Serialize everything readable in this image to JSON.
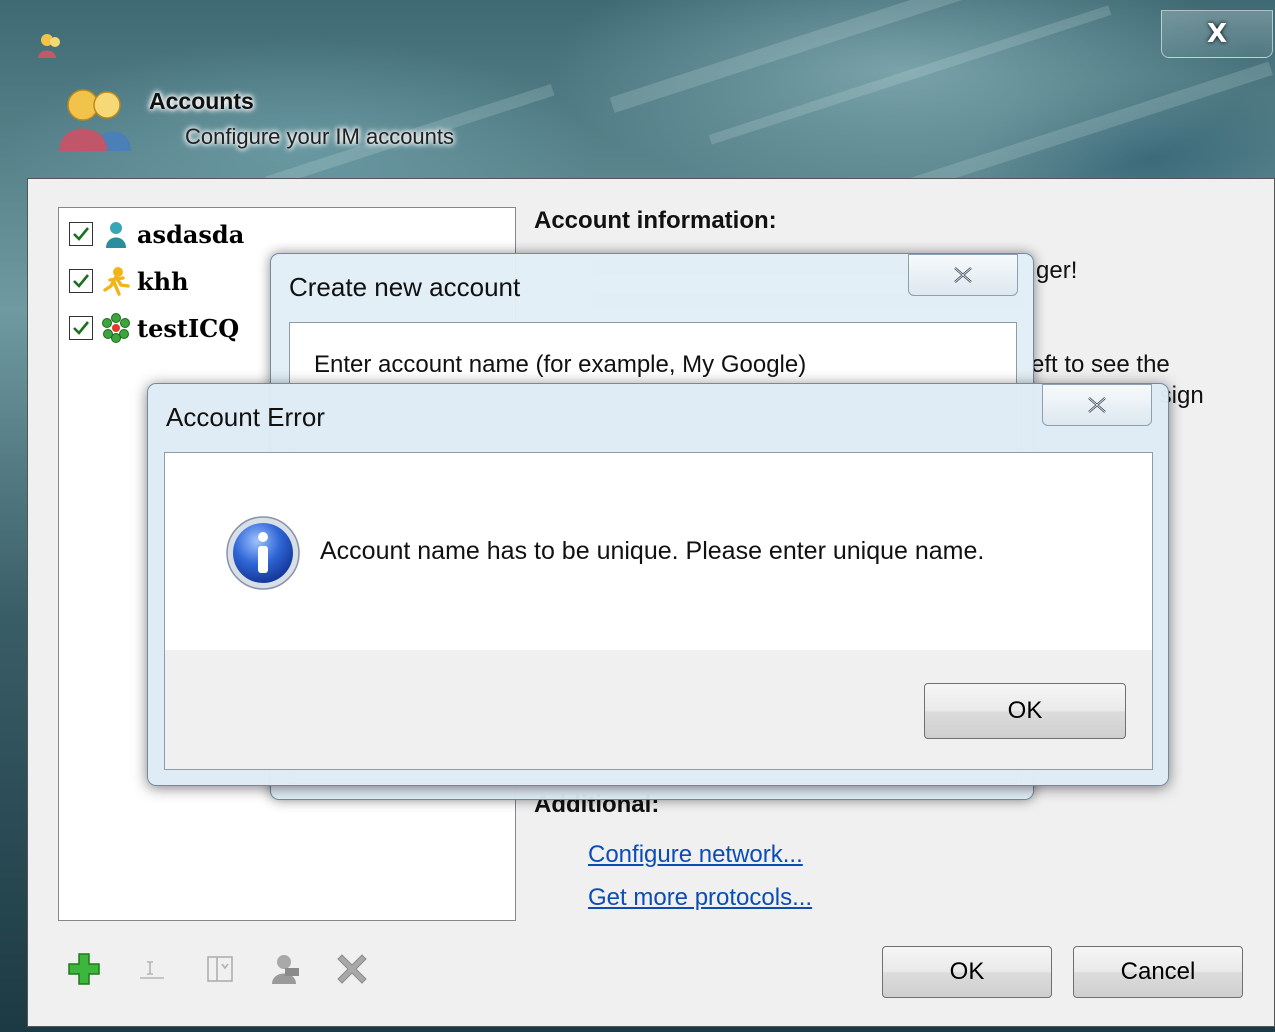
{
  "window": {
    "close_label": "X",
    "header_title": "Accounts",
    "header_subtitle": "Configure your IM accounts"
  },
  "accounts": [
    {
      "name": "asdasda",
      "checked": true,
      "icon": "user-icon"
    },
    {
      "name": "khh",
      "checked": true,
      "icon": "aim-icon"
    },
    {
      "name": "testICQ",
      "checked": true,
      "icon": "icq-flower-icon"
    }
  ],
  "info": {
    "title": "Account information:",
    "fragments": [
      "ger!",
      "eft to see the",
      "s sign"
    ]
  },
  "additional": {
    "title": "Additional:",
    "links": [
      "Configure network...",
      "Get more protocols..."
    ]
  },
  "toolbar": [
    "add-icon",
    "rename-icon",
    "edit-icon",
    "options-icon",
    "delete-icon"
  ],
  "buttons": {
    "ok": "OK",
    "cancel": "Cancel"
  },
  "create_dialog": {
    "title": "Create new account",
    "prompt": "Enter account name (for example, My Google)"
  },
  "error_dialog": {
    "title": "Account Error",
    "message": "Account name has to be unique. Please enter unique name.",
    "ok": "OK",
    "icon": "info-icon"
  }
}
